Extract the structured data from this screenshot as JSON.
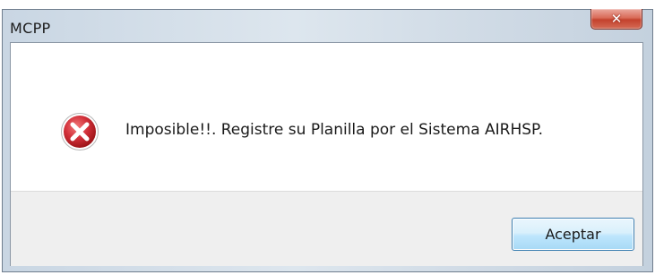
{
  "window": {
    "title": "MCPP",
    "close_icon": "close-icon"
  },
  "dialog": {
    "icon": "error-icon",
    "message": "Imposible!!. Registre su Planilla por el Sistema AIRHSP.",
    "ok_label": "Aceptar"
  },
  "colors": {
    "close_button": "#c3412d",
    "error_icon": "#c8232a",
    "ok_button_border": "#3c7fb1"
  }
}
